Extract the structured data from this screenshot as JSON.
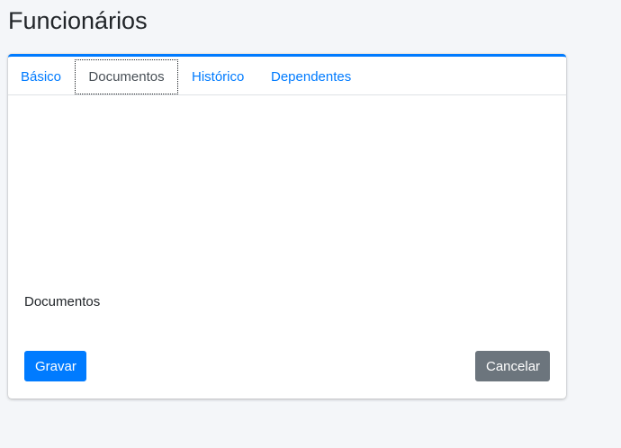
{
  "page": {
    "title": "Funcionários"
  },
  "tabs": [
    {
      "label": "Básico",
      "active": false
    },
    {
      "label": "Documentos",
      "active": true
    },
    {
      "label": "Histórico",
      "active": false
    },
    {
      "label": "Dependentes",
      "active": false
    }
  ],
  "content": {
    "section_label": "Documentos"
  },
  "actions": {
    "save_label": "Gravar",
    "cancel_label": "Cancelar"
  },
  "colors": {
    "primary": "#007bff",
    "secondary": "#6c757d",
    "background": "#f4f6f9"
  }
}
